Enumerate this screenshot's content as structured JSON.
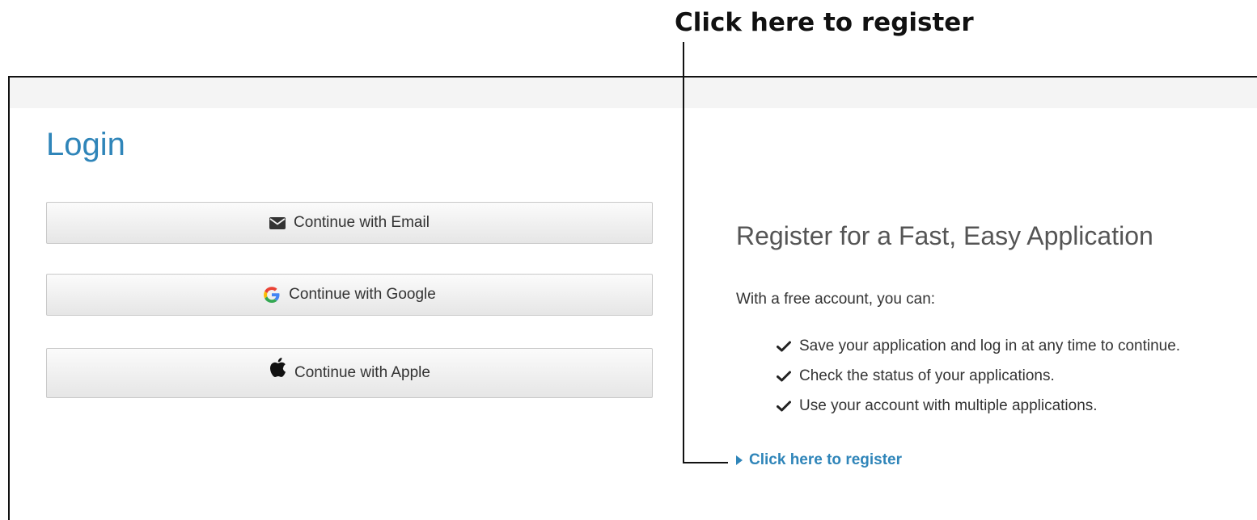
{
  "annotation": {
    "title": "Click here to register"
  },
  "login": {
    "title": "Login",
    "buttons": [
      {
        "label": "Continue with Email",
        "icon": "envelope-icon"
      },
      {
        "label": "Continue with Google",
        "icon": "google-icon"
      },
      {
        "label": "Continue with Apple",
        "icon": "apple-icon"
      }
    ]
  },
  "register": {
    "heading": "Register for a Fast, Easy Application",
    "intro": "With a free account, you can:",
    "benefits": [
      "Save your application and log in at any time to continue.",
      "Check the status of your applications.",
      "Use your account with multiple applications."
    ],
    "link_label": "Click here to register"
  },
  "colors": {
    "accent": "#2f85b9",
    "heading_gray": "#555555"
  }
}
